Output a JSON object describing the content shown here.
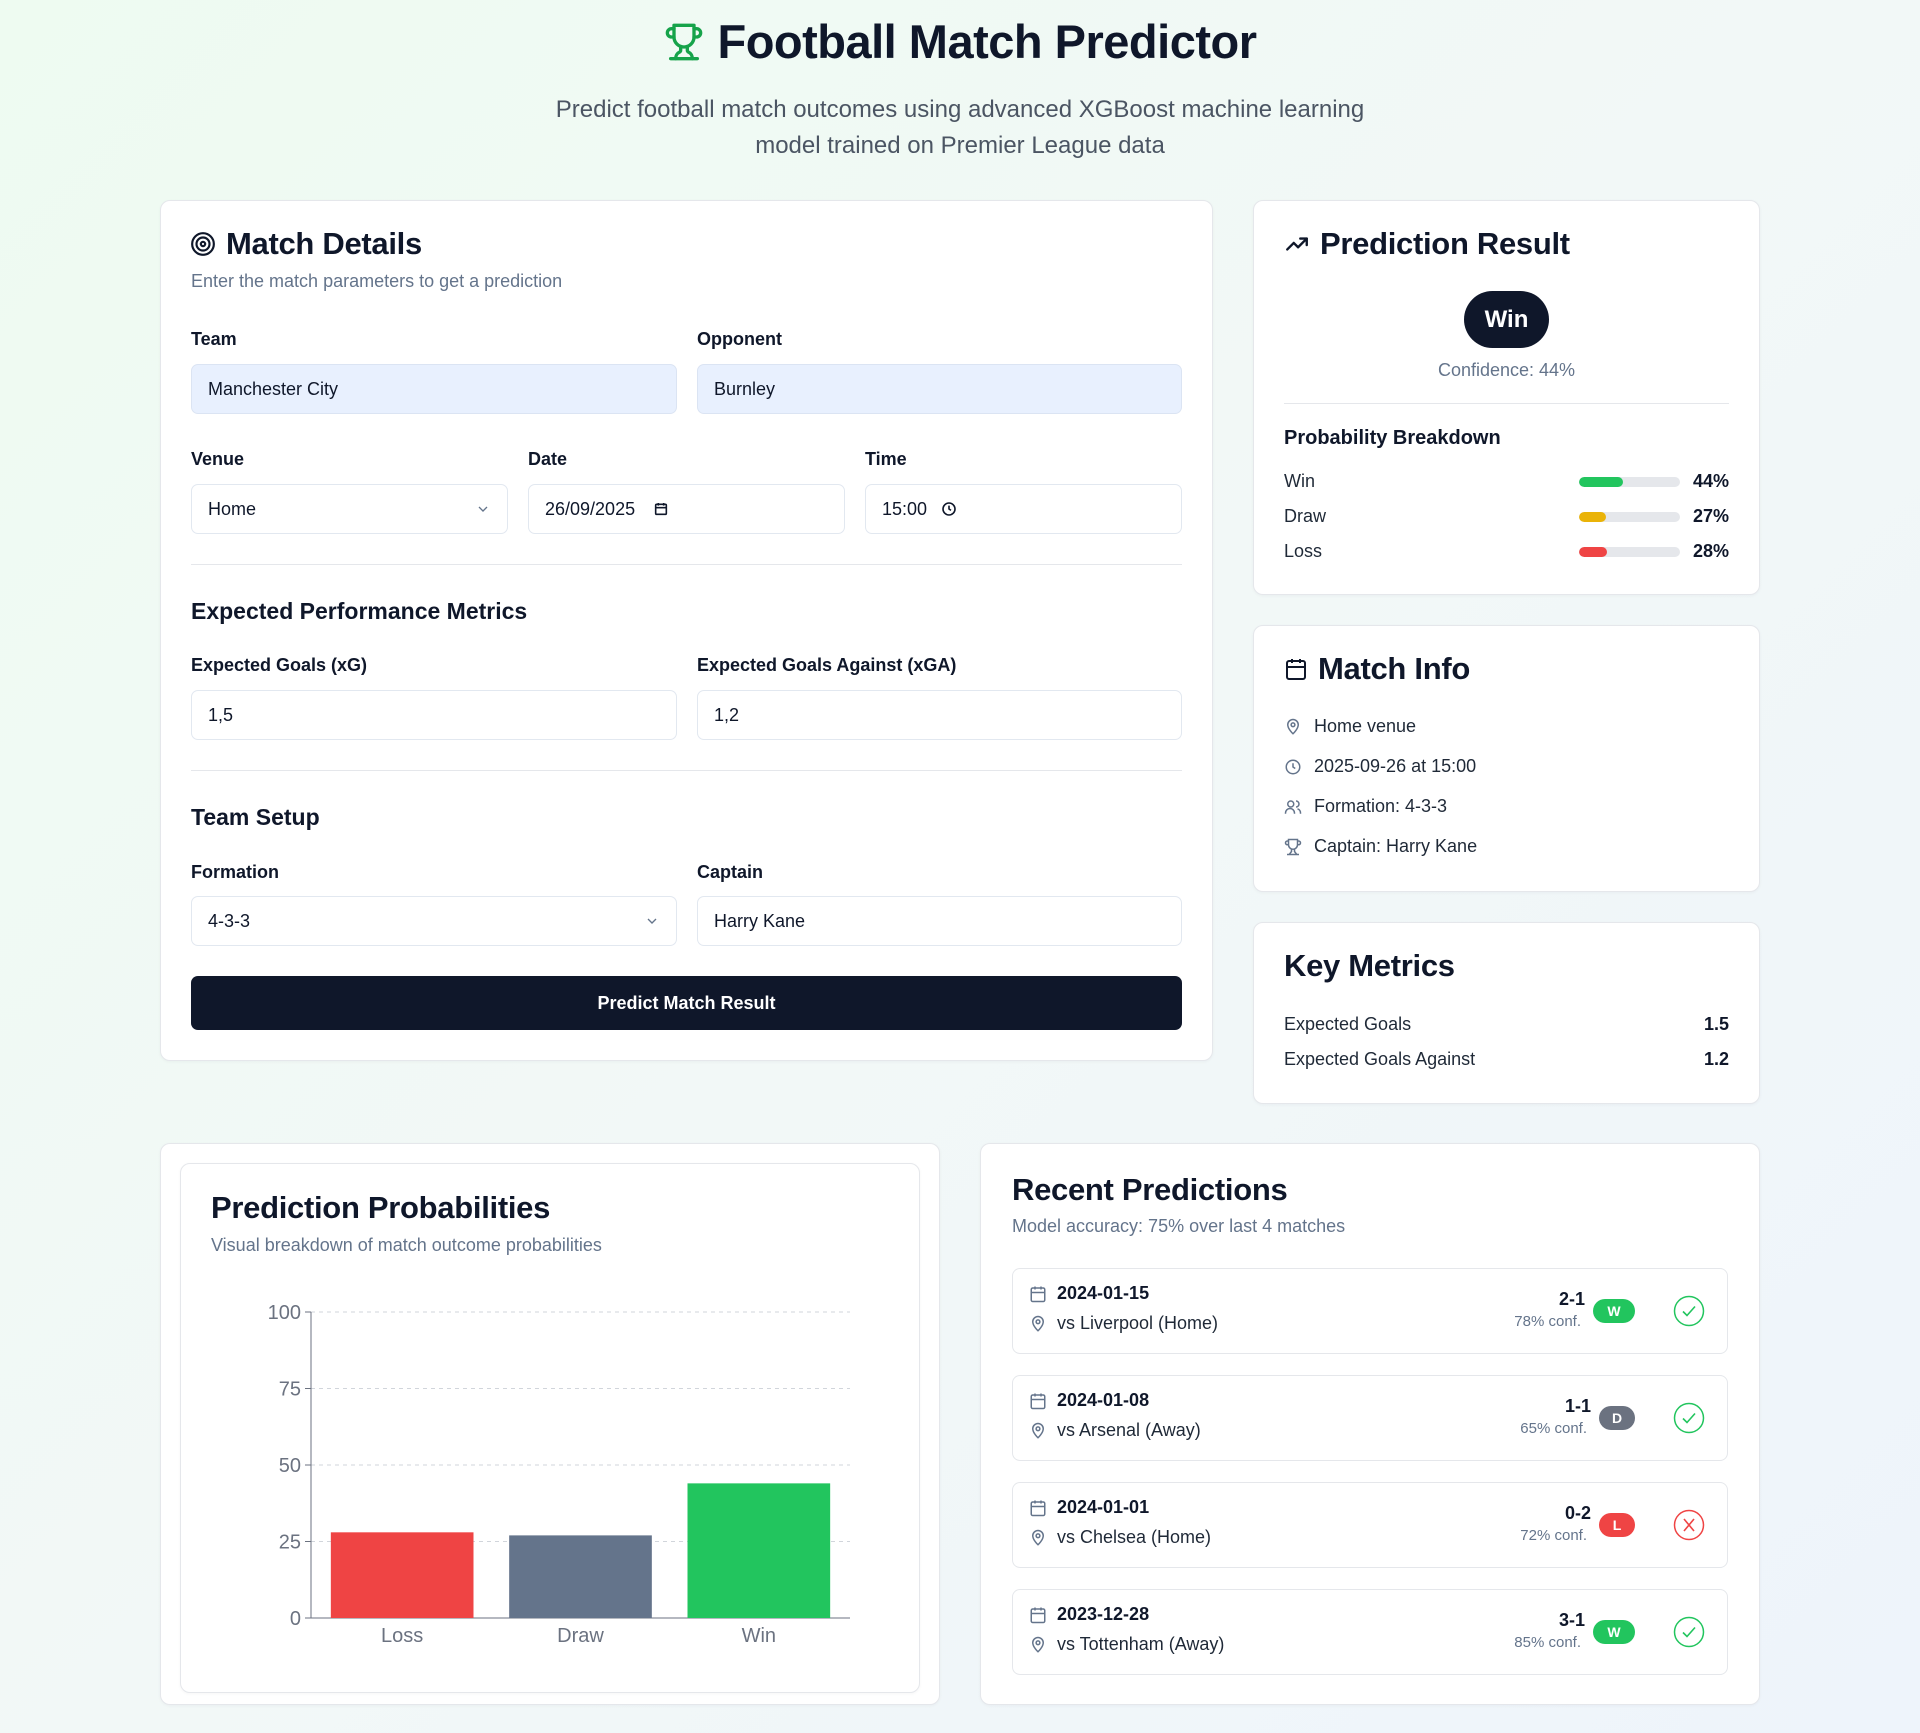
{
  "header": {
    "title": "Football Match Predictor",
    "subtitle_line1": "Predict football match outcomes using advanced XGBoost machine learning",
    "subtitle_line2": "model trained on Premier League data"
  },
  "match_details": {
    "title": "Match Details",
    "subtitle": "Enter the match parameters to get a prediction",
    "team_label": "Team",
    "team_value": "Manchester City",
    "opponent_label": "Opponent",
    "opponent_value": "Burnley",
    "venue_label": "Venue",
    "venue_value": "Home",
    "date_label": "Date",
    "date_value": "26/09/2025",
    "time_label": "Time",
    "time_value": "15:00",
    "metrics_title": "Expected Performance Metrics",
    "xg_label": "Expected Goals (xG)",
    "xg_value": "1,5",
    "xga_label": "Expected Goals Against (xGA)",
    "xga_value": "1,2",
    "setup_title": "Team Setup",
    "formation_label": "Formation",
    "formation_value": "4-3-3",
    "captain_label": "Captain",
    "captain_value": "Harry Kane",
    "predict_button": "Predict Match Result"
  },
  "prediction_result": {
    "title": "Prediction Result",
    "outcome": "Win",
    "confidence": "Confidence: 44%",
    "breakdown_title": "Probability Breakdown",
    "rows": [
      {
        "label": "Win",
        "pct": "44%",
        "value": 44,
        "color": "#22c55e"
      },
      {
        "label": "Draw",
        "pct": "27%",
        "value": 27,
        "color": "#eab308"
      },
      {
        "label": "Loss",
        "pct": "28%",
        "value": 28,
        "color": "#ef4444"
      }
    ]
  },
  "match_info": {
    "title": "Match Info",
    "venue": "Home venue",
    "datetime": "2025-09-26 at 15:00",
    "formation": "Formation: 4-3-3",
    "captain": "Captain: Harry Kane"
  },
  "key_metrics": {
    "title": "Key Metrics",
    "xg_label": "Expected Goals",
    "xg_value": "1.5",
    "xga_label": "Expected Goals Against",
    "xga_value": "1.2"
  },
  "probabilities_chart": {
    "title": "Prediction Probabilities",
    "subtitle": "Visual breakdown of match outcome probabilities"
  },
  "chart_data": {
    "type": "bar",
    "categories": [
      "Loss",
      "Draw",
      "Win"
    ],
    "values": [
      28,
      27,
      44
    ],
    "colors": [
      "#ef4444",
      "#64748b",
      "#22c55e"
    ],
    "ylim": [
      0,
      100
    ],
    "yticks": [
      "0",
      "25",
      "50",
      "75",
      "100"
    ],
    "grid": true
  },
  "recent_predictions": {
    "title": "Recent Predictions",
    "subtitle": "Model accuracy: 75% over last 4 matches",
    "items": [
      {
        "date": "2024-01-15",
        "opponent": "vs Liverpool (Home)",
        "score": "2-1",
        "conf": "78% conf.",
        "result": "W",
        "result_color": "#22c55e",
        "correct": true
      },
      {
        "date": "2024-01-08",
        "opponent": "vs Arsenal (Away)",
        "score": "1-1",
        "conf": "65% conf.",
        "result": "D",
        "result_color": "#6b7280",
        "correct": true
      },
      {
        "date": "2024-01-01",
        "opponent": "vs Chelsea (Home)",
        "score": "0-2",
        "conf": "72% conf.",
        "result": "L",
        "result_color": "#ef4444",
        "correct": false
      },
      {
        "date": "2023-12-28",
        "opponent": "vs Tottenham (Away)",
        "score": "3-1",
        "conf": "85% conf.",
        "result": "W",
        "result_color": "#22c55e",
        "correct": true
      }
    ]
  }
}
